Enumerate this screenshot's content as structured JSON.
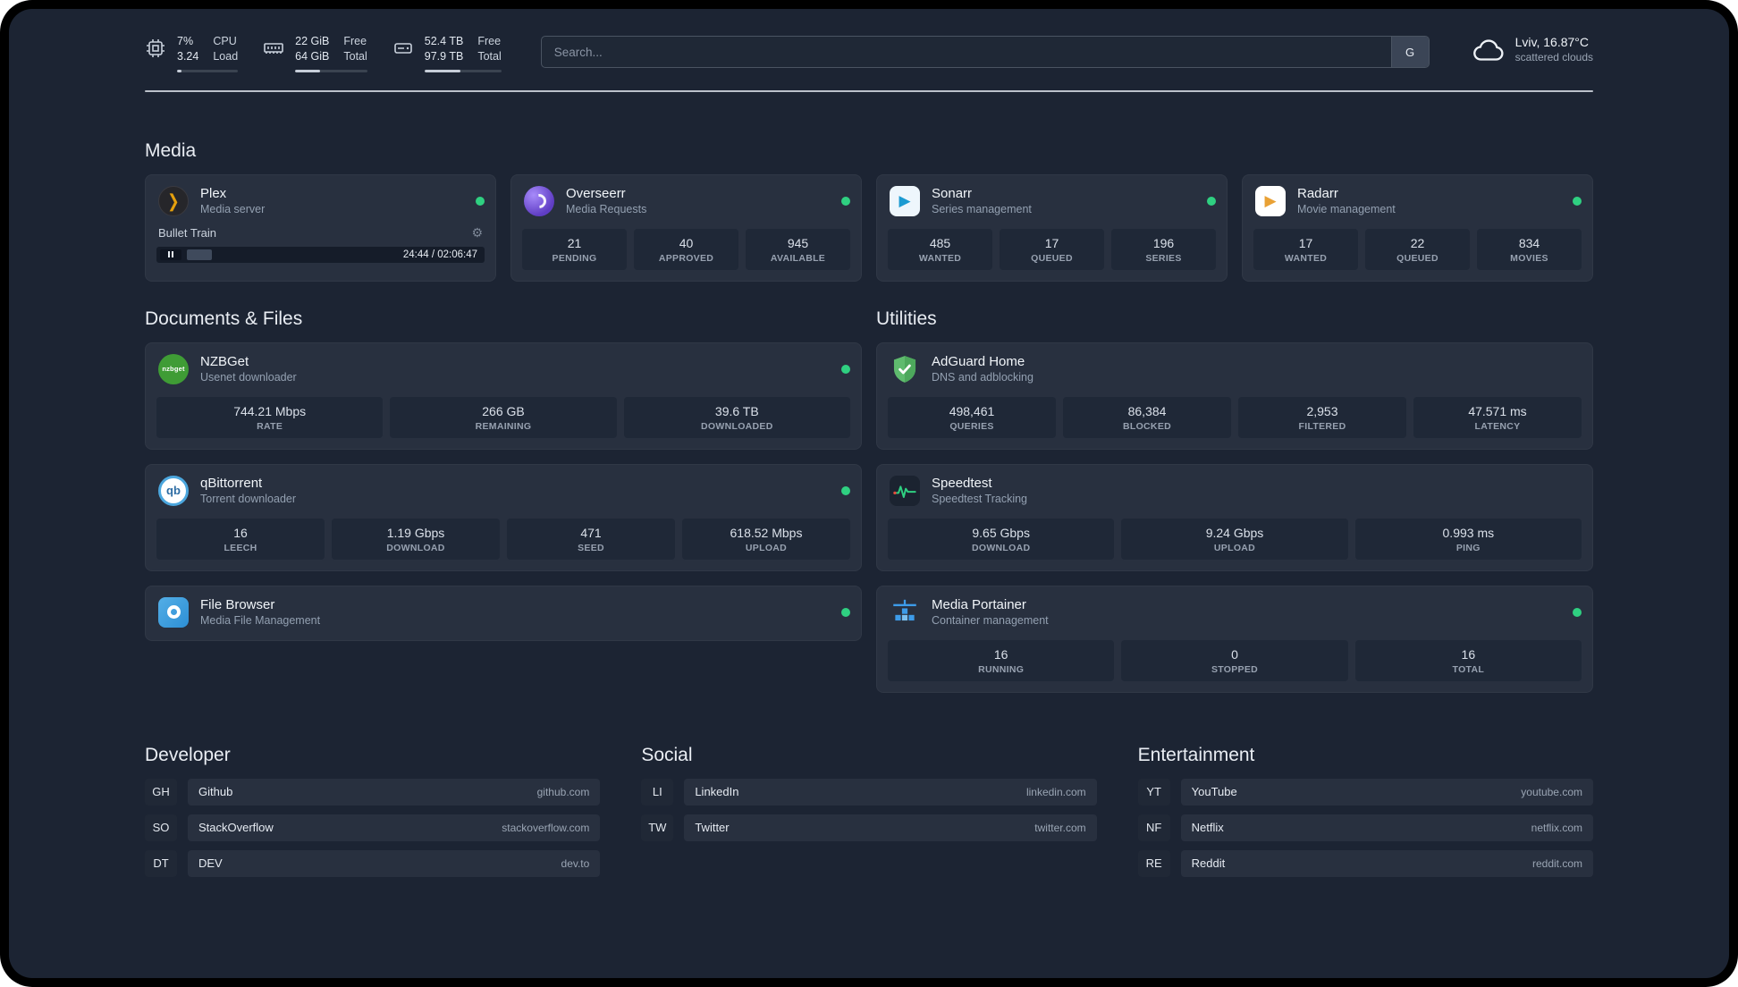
{
  "colors": {
    "page_bg": "#1c2433",
    "status_online": "#2fd081",
    "plex_accent": "#e5a00d"
  },
  "header": {
    "cpu": {
      "value1": "7%",
      "label1": "CPU",
      "value2": "3.24",
      "label2": "Load"
    },
    "memory": {
      "value1": "22 GiB",
      "label1": "Free",
      "value2": "64 GiB",
      "label2": "Total"
    },
    "disk": {
      "value1": "52.4 TB",
      "label1": "Free",
      "value2": "97.9 TB",
      "label2": "Total"
    },
    "search": {
      "placeholder": "Search...",
      "button_label": "G"
    },
    "weather": {
      "location": "Lviv, 16.87°C",
      "condition": "scattered clouds"
    }
  },
  "sections": {
    "media": {
      "title": "Media",
      "plex": {
        "name": "Plex",
        "subtitle": "Media server",
        "now_playing": "Bullet Train",
        "time": "24:44 / 02:06:47"
      },
      "overseerr": {
        "name": "Overseerr",
        "subtitle": "Media Requests",
        "stats": [
          {
            "value": "21",
            "label": "PENDING"
          },
          {
            "value": "40",
            "label": "APPROVED"
          },
          {
            "value": "945",
            "label": "AVAILABLE"
          }
        ]
      },
      "sonarr": {
        "name": "Sonarr",
        "subtitle": "Series management",
        "stats": [
          {
            "value": "485",
            "label": "WANTED"
          },
          {
            "value": "17",
            "label": "QUEUED"
          },
          {
            "value": "196",
            "label": "SERIES"
          }
        ]
      },
      "radarr": {
        "name": "Radarr",
        "subtitle": "Movie management",
        "stats": [
          {
            "value": "17",
            "label": "WANTED"
          },
          {
            "value": "22",
            "label": "QUEUED"
          },
          {
            "value": "834",
            "label": "MOVIES"
          }
        ]
      }
    },
    "documents": {
      "title": "Documents & Files",
      "nzbget": {
        "name": "NZBGet",
        "subtitle": "Usenet downloader",
        "stats": [
          {
            "value": "744.21 Mbps",
            "label": "RATE"
          },
          {
            "value": "266 GB",
            "label": "REMAINING"
          },
          {
            "value": "39.6 TB",
            "label": "DOWNLOADED"
          }
        ]
      },
      "qbittorrent": {
        "name": "qBittorrent",
        "subtitle": "Torrent downloader",
        "stats": [
          {
            "value": "16",
            "label": "LEECH"
          },
          {
            "value": "1.19 Gbps",
            "label": "DOWNLOAD"
          },
          {
            "value": "471",
            "label": "SEED"
          },
          {
            "value": "618.52 Mbps",
            "label": "UPLOAD"
          }
        ]
      },
      "filebrowser": {
        "name": "File Browser",
        "subtitle": "Media File Management"
      }
    },
    "utilities": {
      "title": "Utilities",
      "adguard": {
        "name": "AdGuard Home",
        "subtitle": "DNS and adblocking",
        "stats": [
          {
            "value": "498,461",
            "label": "QUERIES"
          },
          {
            "value": "86,384",
            "label": "BLOCKED"
          },
          {
            "value": "2,953",
            "label": "FILTERED"
          },
          {
            "value": "47.571 ms",
            "label": "LATENCY"
          }
        ]
      },
      "speedtest": {
        "name": "Speedtest",
        "subtitle": "Speedtest Tracking",
        "stats": [
          {
            "value": "9.65 Gbps",
            "label": "DOWNLOAD"
          },
          {
            "value": "9.24 Gbps",
            "label": "UPLOAD"
          },
          {
            "value": "0.993 ms",
            "label": "PING"
          }
        ]
      },
      "portainer": {
        "name": "Media Portainer",
        "subtitle": "Container management",
        "stats": [
          {
            "value": "16",
            "label": "RUNNING"
          },
          {
            "value": "0",
            "label": "STOPPED"
          },
          {
            "value": "16",
            "label": "TOTAL"
          }
        ]
      }
    }
  },
  "bookmarks": {
    "developer": {
      "title": "Developer",
      "items": [
        {
          "abbr": "GH",
          "name": "Github",
          "domain": "github.com"
        },
        {
          "abbr": "SO",
          "name": "StackOverflow",
          "domain": "stackoverflow.com"
        },
        {
          "abbr": "DT",
          "name": "DEV",
          "domain": "dev.to"
        }
      ]
    },
    "social": {
      "title": "Social",
      "items": [
        {
          "abbr": "LI",
          "name": "LinkedIn",
          "domain": "linkedin.com"
        },
        {
          "abbr": "TW",
          "name": "Twitter",
          "domain": "twitter.com"
        }
      ]
    },
    "entertainment": {
      "title": "Entertainment",
      "items": [
        {
          "abbr": "YT",
          "name": "YouTube",
          "domain": "youtube.com"
        },
        {
          "abbr": "NF",
          "name": "Netflix",
          "domain": "netflix.com"
        },
        {
          "abbr": "RE",
          "name": "Reddit",
          "domain": "reddit.com"
        }
      ]
    }
  },
  "icons": {
    "nzbget_text": "nzbget",
    "qb_text": "qb"
  }
}
